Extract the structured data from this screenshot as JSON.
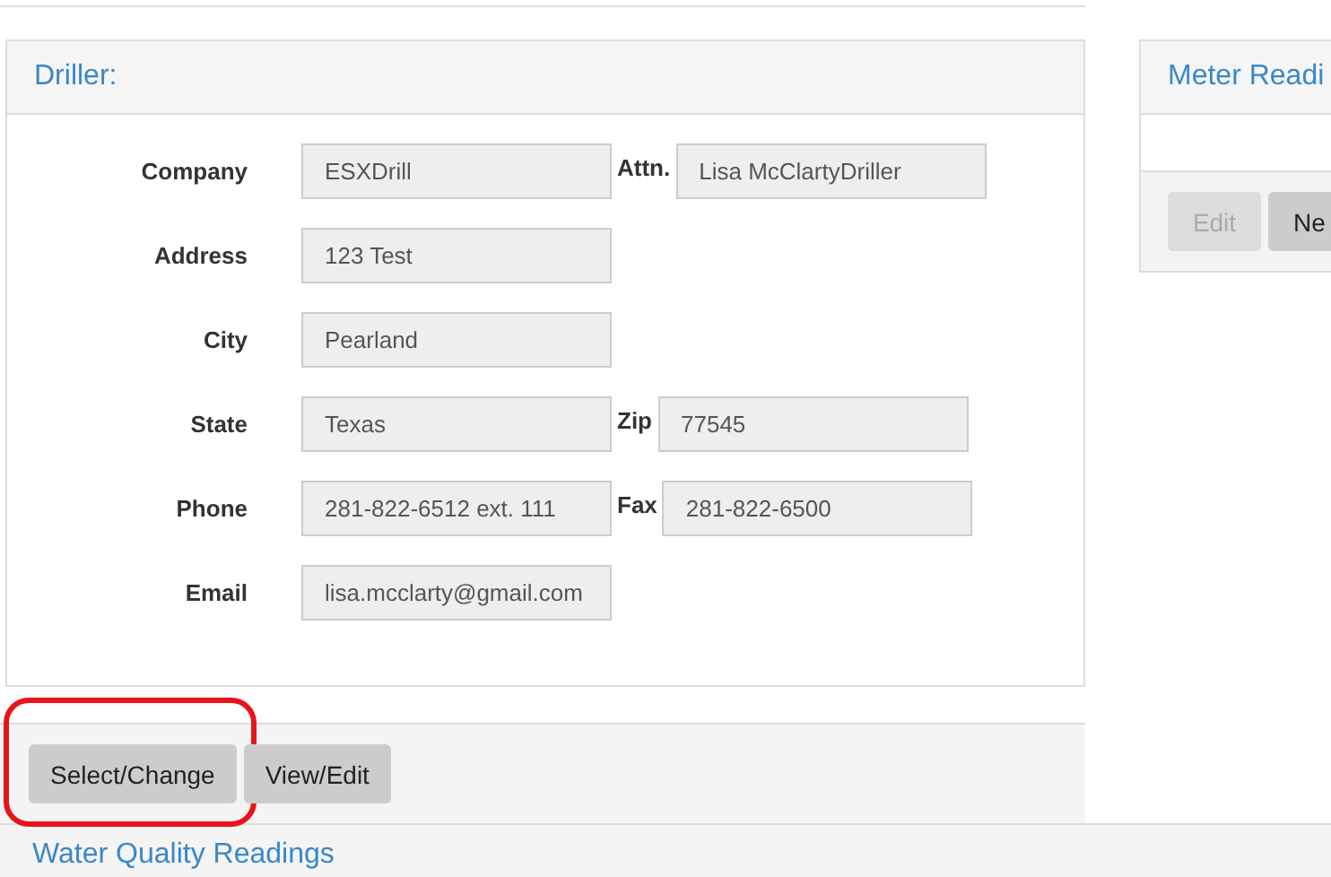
{
  "driller_panel": {
    "title": "Driller:",
    "rows": [
      {
        "label": "Company",
        "value": "ESXDrill",
        "side": {
          "label": "Attn.",
          "value": "Lisa McClartyDriller"
        }
      },
      {
        "label": "Address",
        "value": "123 Test"
      },
      {
        "label": "City",
        "value": "Pearland"
      },
      {
        "label": "State",
        "value": "Texas",
        "side": {
          "label": "Zip",
          "value": "77545"
        }
      },
      {
        "label": "Phone",
        "value": "281-822-6512 ext. 111",
        "side": {
          "label": "Fax",
          "value": "281-822-6500"
        }
      },
      {
        "label": "Email",
        "value": "lisa.mcclarty@gmail.com"
      }
    ],
    "buttons": [
      {
        "label": "Select/Change",
        "highlighted": true
      },
      {
        "label": "View/Edit",
        "highlighted": false
      }
    ]
  },
  "meter_panel": {
    "title": "Meter Readi",
    "buttons": [
      {
        "label": "Edit",
        "disabled": true
      },
      {
        "label": "Ne",
        "disabled": false
      }
    ]
  },
  "water_quality_panel": {
    "title": "Water Quality Readings"
  }
}
